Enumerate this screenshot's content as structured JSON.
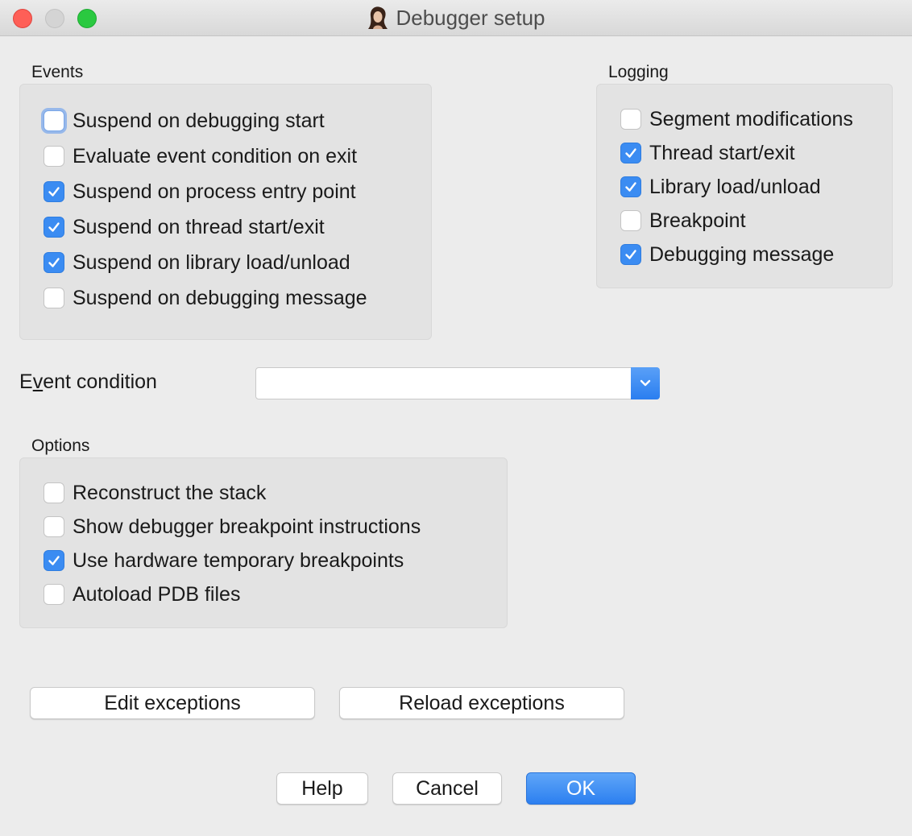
{
  "window": {
    "title": "Debugger setup"
  },
  "events": {
    "label": "Events",
    "items": [
      {
        "label": "Suspend on debugging start",
        "checked": false
      },
      {
        "label": "Evaluate event condition on exit",
        "checked": false
      },
      {
        "label": "Suspend on process entry point",
        "checked": true
      },
      {
        "label": "Suspend on thread start/exit",
        "checked": true
      },
      {
        "label": "Suspend on library load/unload",
        "checked": true
      },
      {
        "label": "Suspend on debugging message",
        "checked": false
      }
    ]
  },
  "logging": {
    "label": "Logging",
    "items": [
      {
        "label": "Segment modifications",
        "checked": false
      },
      {
        "label": "Thread start/exit",
        "checked": true
      },
      {
        "label": "Library load/unload",
        "checked": true
      },
      {
        "label": "Breakpoint",
        "checked": false
      },
      {
        "label": "Debugging message",
        "checked": true
      }
    ]
  },
  "event_condition": {
    "label_pre": "E",
    "label_underline": "v",
    "label_post": "ent condition",
    "value": ""
  },
  "options": {
    "label": "Options",
    "items": [
      {
        "label": "Reconstruct the stack",
        "checked": false
      },
      {
        "label": "Show debugger breakpoint instructions",
        "checked": false
      },
      {
        "label": "Use hardware temporary breakpoints",
        "checked": true
      },
      {
        "label": "Autoload PDB files",
        "checked": false
      }
    ]
  },
  "buttons": {
    "edit_exceptions": "Edit exceptions",
    "reload_exceptions": "Reload exceptions",
    "help": "Help",
    "cancel": "Cancel",
    "ok": "OK"
  },
  "colors": {
    "accent": "#3b8cf2",
    "background": "#ececec"
  }
}
